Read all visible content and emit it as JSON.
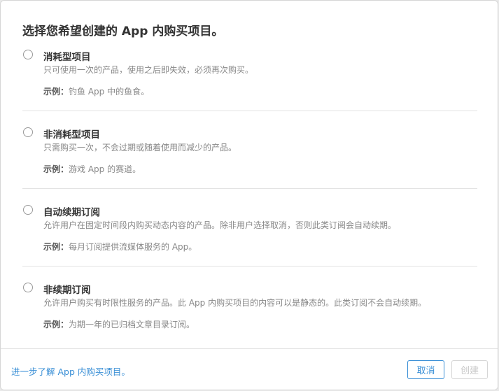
{
  "dialog": {
    "title": "选择您希望创建的 App 内购买项目。"
  },
  "options": [
    {
      "title": "消耗型项目",
      "description": "只可使用一次的产品，使用之后即失效，必须再次购买。",
      "example_label": "示例：",
      "example_text": "钓鱼 App 中的鱼食。",
      "selected": false
    },
    {
      "title": "非消耗型项目",
      "description": "只需购买一次，不会过期或随着使用而减少的产品。",
      "example_label": "示例：",
      "example_text": "游戏 App 的赛道。",
      "selected": false
    },
    {
      "title": "自动续期订阅",
      "description": "允许用户在固定时间段内购买动态内容的产品。除非用户选择取消，否则此类订阅会自动续期。",
      "example_label": "示例：",
      "example_text": "每月订阅提供流媒体服务的 App。",
      "selected": false
    },
    {
      "title": "非续期订阅",
      "description": "允许用户购买有时限性服务的产品。此 App 内购买项目的内容可以是静态的。此类订阅不会自动续期。",
      "example_label": "示例：",
      "example_text": "为期一年的已归档文章目录订阅。",
      "selected": false
    }
  ],
  "footer": {
    "learn_more": "进一步了解 App 内购买项目。",
    "cancel_label": "取消",
    "create_label": "创建",
    "create_enabled": false
  },
  "colors": {
    "accent": "#3a8fd6",
    "disabled": "#c8c8c8"
  }
}
